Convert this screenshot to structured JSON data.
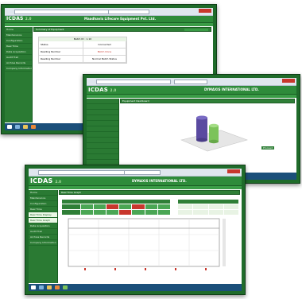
{
  "app": {
    "logo": "ICDAS",
    "version": "2.0"
  },
  "screen1": {
    "company": "Maadhavis Lifecare Equipment Pvt. Ltd.",
    "sidebar": [
      "Home",
      "Maintenance",
      "Configuration",
      "Real Time",
      "Data Acquisition",
      "Audit Trail",
      "Archive Records",
      "Company Information"
    ],
    "panel_title": "Summary of Equipment",
    "table_header": "Batch ID : 1.10",
    "rows": [
      {
        "label": "Status",
        "value": "Connected"
      },
      {
        "label": "Reading Number",
        "value": "Batch Done"
      },
      {
        "label": "Reading Number",
        "value": "Normal Batch Status"
      }
    ]
  },
  "screen2": {
    "company": "DYMAXIS INTERNATIONAL LTD.",
    "panel_title": "Equipment Dashboard",
    "action_button": "Proceed"
  },
  "screen3": {
    "company": "DYMAXIS INTERNATIONAL LTD.",
    "panel_title": "Real Time Graph",
    "sidebar": [
      "Home",
      "Maintenance",
      "Configuration",
      "Real Time",
      "Real Time Display",
      "Real Time Graph",
      "Data Acquisition",
      "Audit Trail",
      "Archive Records",
      "Company Information"
    ]
  },
  "colors": {
    "frame": "#1f6b2a",
    "appbar": "#2e8b3a",
    "accent_red": "#c8372d",
    "cylinder_purple": "#5a4aa0",
    "cylinder_green": "#7cc35a"
  }
}
